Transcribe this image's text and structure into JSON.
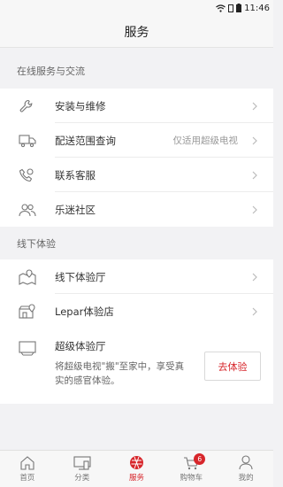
{
  "status_bar": {
    "time": "11:46"
  },
  "header": {
    "title": "服务"
  },
  "online_section": {
    "title": "在线服务与交流",
    "items": [
      {
        "label": "安装与维修",
        "hint": ""
      },
      {
        "label": "配送范围查询",
        "hint": "仅适用超级电视"
      },
      {
        "label": "联系客服",
        "hint": ""
      },
      {
        "label": "乐迷社区",
        "hint": ""
      }
    ]
  },
  "offline_section": {
    "title": "线下体验",
    "items": [
      {
        "label": "线下体验厅"
      },
      {
        "label": "Lepar体验店"
      }
    ],
    "experience": {
      "title": "超级体验厅",
      "desc": "将超级电视\"搬\"至家中，享受真实的感官体验。",
      "button": "去体验"
    }
  },
  "tabbar": {
    "tabs": [
      {
        "label": "首页"
      },
      {
        "label": "分类"
      },
      {
        "label": "服务"
      },
      {
        "label": "购物车",
        "badge": "6"
      },
      {
        "label": "我的"
      }
    ],
    "active_color": "#d7262b"
  }
}
